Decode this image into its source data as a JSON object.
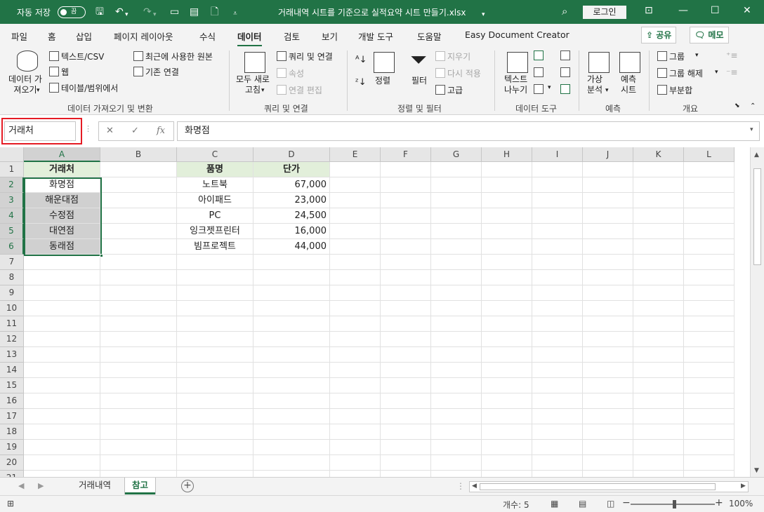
{
  "titlebar": {
    "autosave_label": "자동 저장",
    "autosave_state": "끔",
    "doc_title": "거래내역 시트를 기준으로 실적요약 시트 만들기.xlsx",
    "login": "로그인"
  },
  "tabs": [
    "파일",
    "홈",
    "삽입",
    "페이지 레이아웃",
    "수식",
    "데이터",
    "검토",
    "보기",
    "개발 도구",
    "도움말",
    "Easy Document Creator"
  ],
  "active_tab": "데이터",
  "share": "공유",
  "memo": "메모",
  "ribbon": {
    "get_data": "데이터 가\n져오기",
    "text_csv": "텍스트/CSV",
    "web": "웹",
    "table_range": "테이블/범위에서",
    "recent_sources": "최근에 사용한 원본",
    "existing_connections": "기존 연결",
    "group_get_transform": "데이터 가져오기 및 변환",
    "refresh_all": "모두 새로\n고침",
    "queries_connections": "쿼리 및 연결",
    "properties": "속성",
    "edit_links": "연결 편집",
    "group_queries": "쿼리 및 연결",
    "sort": "정렬",
    "filter": "필터",
    "clear": "지우기",
    "reapply": "다시 적용",
    "advanced": "고급",
    "group_sort_filter": "정렬 및 필터",
    "text_to_columns": "텍스트\n나누기",
    "group_data_tools": "데이터 도구",
    "what_if": "가상\n분석",
    "forecast_sheet": "예측\n시트",
    "group_forecast": "예측",
    "group": "그룹",
    "ungroup": "그룹 해제",
    "subtotal": "부분합",
    "group_outline": "개요"
  },
  "formula_bar": {
    "name_box": "거래처",
    "formula": "화명점"
  },
  "columns": [
    "A",
    "B",
    "C",
    "D",
    "E",
    "F",
    "G",
    "H",
    "I",
    "J",
    "K",
    "L"
  ],
  "rows": [
    "1",
    "2",
    "3",
    "4",
    "5",
    "6",
    "7",
    "8",
    "9",
    "10",
    "11",
    "12",
    "13",
    "14",
    "15",
    "16",
    "17",
    "18",
    "19",
    "20",
    "21"
  ],
  "sheet": {
    "A1": "거래처",
    "A2": "화명점",
    "A3": "해운대점",
    "A4": "수정점",
    "A5": "대연점",
    "A6": "동래점",
    "C1": "품명",
    "D1": "단가",
    "C2": "노트북",
    "D2": "67,000",
    "C3": "아이패드",
    "D3": "23,000",
    "C4": "PC",
    "D4": "24,500",
    "C5": "잉크젯프린터",
    "D5": "16,000",
    "C6": "빔프로젝트",
    "D6": "44,000"
  },
  "sheet_tabs": [
    "거래내역",
    "참고"
  ],
  "active_sheet": "참고",
  "status": {
    "count": "개수: 5",
    "zoom": "100%"
  },
  "colors": {
    "accent": "#217346",
    "header_fill": "#e2efda",
    "selected_fill": "#d0d0d0",
    "highlight": "#e51b24"
  }
}
